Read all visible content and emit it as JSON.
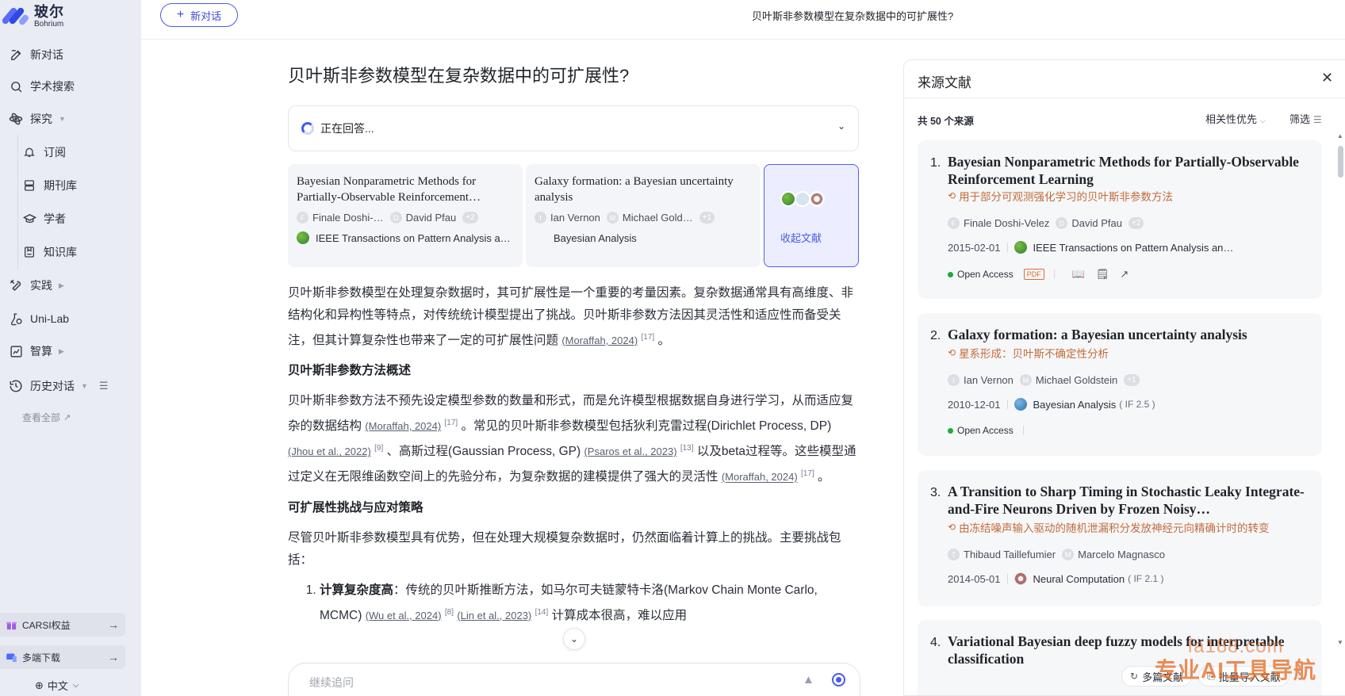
{
  "brand": {
    "name_cn": "玻尔",
    "name_en": "Bohrium",
    "colors": {
      "accent": "#3b5bff",
      "translation": "#c26b3a",
      "open_access": "#1faa3b"
    }
  },
  "sidebar": {
    "items": [
      {
        "label": "新对话",
        "icon": "edit-icon"
      },
      {
        "label": "学术搜索",
        "icon": "search-icon"
      },
      {
        "label": "探究",
        "icon": "explore-icon"
      },
      {
        "label": "订阅",
        "icon": "bell-icon"
      },
      {
        "label": "期刊库",
        "icon": "journal-icon"
      },
      {
        "label": "学者",
        "icon": "graduation-cap-icon"
      },
      {
        "label": "知识库",
        "icon": "knowledge-base-icon"
      },
      {
        "label": "实践",
        "icon": "tools-icon"
      },
      {
        "label": "Uni-Lab",
        "icon": "flask-icon"
      },
      {
        "label": "智算",
        "icon": "compute-icon"
      },
      {
        "label": "历史对话",
        "icon": "history-icon"
      }
    ],
    "view_all": "查看全部",
    "carsi": "CARSI权益",
    "download": "多端下载",
    "language": "中文"
  },
  "topbar": {
    "new_chat": "新对话",
    "title": "贝叶斯非参数模型在复杂数据中的可扩展性?"
  },
  "question": {
    "title": "贝叶斯非参数模型在复杂数据中的可扩展性?",
    "status": "正在回答..."
  },
  "ref_cards": [
    {
      "title": "Bayesian Nonparametric Methods for Partially-Observable Reinforcement…",
      "author1_initial": "F",
      "author1": "Finale Doshi-…",
      "author2_initial": "D",
      "author2": "David Pfau",
      "more": "+2",
      "journal": "IEEE Transactions on Pattern Analysis a…"
    },
    {
      "title": "Galaxy formation: a Bayesian uncertainty analysis",
      "author1_initial": "I",
      "author1": "Ian Vernon",
      "author2_initial": "M",
      "author2": "Michael Gold…",
      "more": "+1",
      "journal": "Bayesian Analysis"
    }
  ],
  "collapse_label": "收起文献",
  "answer": {
    "p1": "贝叶斯非参数模型在处理复杂数据时，其可扩展性是一个重要的考量因素。复杂数据通常具有高维度、非结构化和异构性等特点，对传统统计模型提出了挑战。贝叶斯非参数方法因其灵活性和适应性而备受关注，但其计算复杂性也带来了一定的可扩展性问题 ",
    "p1_cite": "(Moraffah, 2024)",
    "p1_sup": "[17]",
    "p1_end": " 。",
    "h1": "贝叶斯非参数方法概述",
    "p2a": "贝叶斯非参数方法不预先设定模型参数的数量和形式，而是允许模型根据数据自身进行学习，从而适应复杂的数据结构 ",
    "p2_cite1": "(Moraffah, 2024)",
    "p2_sup1": "[17]",
    "p2b": " 。常见的贝叶斯非参数模型包括狄利克雷过程(Dirichlet Process, DP) ",
    "p2_cite2": "(Jhou et al., 2022)",
    "p2_sup2": "[9]",
    "p2c": " 、高斯过程(Gaussian Process, GP) ",
    "p2_cite3": "(Psaros et al., 2023)",
    "p2_sup3": "[13]",
    "p2d": " 以及beta过程等。这些模型通过定义在无限维函数空间上的先验分布，为复杂数据的建模提供了强大的灵活性 ",
    "p2_cite4": "(Moraffah, 2024)",
    "p2_sup4": "[17]",
    "p2_end": " 。",
    "h2": "可扩展性挑战与应对策略",
    "p3": "尽管贝叶斯非参数模型具有优势，但在处理大规模复杂数据时，仍然面临着计算上的挑战。主要挑战包括：",
    "li1_bold": "计算复杂度高",
    "li1a": "：传统的贝叶斯推断方法，如马尔可夫链蒙特卡洛(Markov Chain Monte Carlo, MCMC) ",
    "li1_cite1": "(Wu et al., 2024)",
    "li1_sup1": "[8]",
    "li1_cite2": "(Lin et al., 2023)",
    "li1_sup2": "[14]",
    "li1b": " 计算成本很高，难以应用"
  },
  "followup": {
    "placeholder": "继续追问"
  },
  "sources": {
    "title": "来源文献",
    "count_prefix": "共 ",
    "count": "50",
    "count_suffix": " 个来源",
    "sort": "相关性优先",
    "filter": "筛选",
    "items": [
      {
        "num": "1.",
        "title": "Bayesian Nonparametric Methods for Partially-Observable Reinforcement Learning",
        "translation": "用于部分可观测强化学习的贝叶斯非参数方法",
        "author1_initial": "F",
        "author1": "Finale Doshi-Velez",
        "author2_initial": "D",
        "author2": "David Pfau",
        "more": "+2",
        "date": "2015-02-01",
        "journal": "IEEE Transactions on Pattern Analysis an…",
        "open_access": "Open Access",
        "pdf": "PDF"
      },
      {
        "num": "2.",
        "title": "Galaxy formation: a Bayesian uncertainty analysis",
        "translation": "星系形成：贝叶斯不确定性分析",
        "author1_initial": "I",
        "author1": "Ian Vernon",
        "author2_initial": "M",
        "author2": "Michael Goldstein",
        "more": "+1",
        "date": "2010-12-01",
        "journal": "Bayesian Analysis",
        "if": "( IF 2.5 )",
        "open_access": "Open Access"
      },
      {
        "num": "3.",
        "title": "A Transition to Sharp Timing in Stochastic Leaky Integrate-and-Fire Neurons Driven by Frozen Noisy…",
        "translation": "由冻结噪声输入驱动的随机泄漏积分发放神经元向精确计时的转变",
        "author1_initial": "T",
        "author1": "Thibaud Taillefumier",
        "author2_initial": "M",
        "author2": "Marcelo Magnasco",
        "date": "2014-05-01",
        "journal": "Neural Computation",
        "if": "( IF 2.1 )"
      },
      {
        "num": "4.",
        "title": "Variational Bayesian deep fuzzy models for interpretable classification"
      }
    ],
    "bottom_actions": [
      "多篇文献",
      "批量导入文献"
    ]
  },
  "watermark": {
    "line1": "fa188.com",
    "line2": "专业AI工具导航"
  }
}
